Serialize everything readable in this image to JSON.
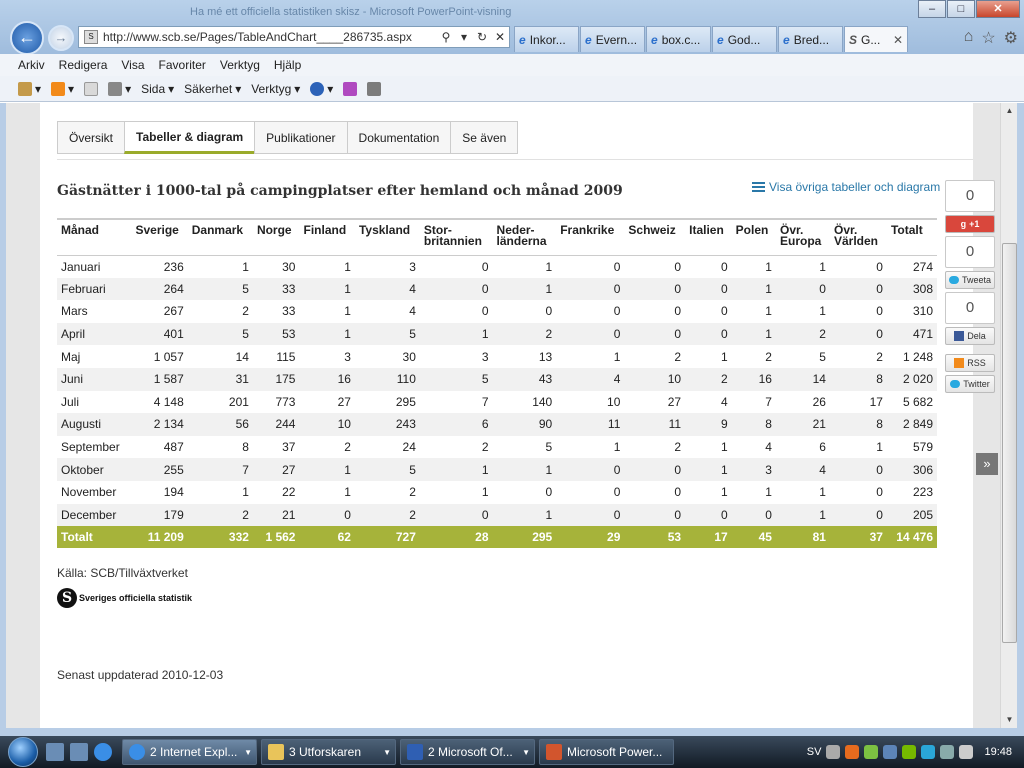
{
  "window": {
    "title": "Ha mé ett officiella statistiken skisz - Microsoft PowerPoint-visning"
  },
  "browser": {
    "url": "http://www.scb.se/Pages/TableAndChart____286735.aspx",
    "tabs": [
      {
        "label": "Inkor..."
      },
      {
        "label": "Evern..."
      },
      {
        "label": "box.c..."
      },
      {
        "label": "God..."
      },
      {
        "label": "Bred..."
      },
      {
        "label": "G..."
      }
    ],
    "menu": [
      "Arkiv",
      "Redigera",
      "Visa",
      "Favoriter",
      "Verktyg",
      "Hjälp"
    ],
    "toolbar": {
      "sida": "Sida",
      "sakerhet": "Säkerhet",
      "verktyg": "Verktyg"
    }
  },
  "content_tabs": [
    "Översikt",
    "Tabeller & diagram",
    "Publikationer",
    "Dokumentation",
    "Se även"
  ],
  "table_title": "Gästnätter i 1000-tal på campingplatser efter hemland och månad 2009",
  "more_link": "Visa övriga tabeller och diagram",
  "columns": [
    "Månad",
    "Sverige",
    "Danmark",
    "Norge",
    "Finland",
    "Tyskland",
    "Stor-\nbritannien",
    "Neder-\nländerna",
    "Frankrike",
    "Schweiz",
    "Italien",
    "Polen",
    "Övr.\nEuropa",
    "Övr.\nVärlden",
    "Totalt"
  ],
  "rows": [
    [
      "Januari",
      "236",
      "1",
      "30",
      "1",
      "3",
      "0",
      "1",
      "0",
      "0",
      "0",
      "1",
      "1",
      "0",
      "274"
    ],
    [
      "Februari",
      "264",
      "5",
      "33",
      "1",
      "4",
      "0",
      "1",
      "0",
      "0",
      "0",
      "1",
      "0",
      "0",
      "308"
    ],
    [
      "Mars",
      "267",
      "2",
      "33",
      "1",
      "4",
      "0",
      "0",
      "0",
      "0",
      "0",
      "1",
      "1",
      "0",
      "310"
    ],
    [
      "April",
      "401",
      "5",
      "53",
      "1",
      "5",
      "1",
      "2",
      "0",
      "0",
      "0",
      "1",
      "2",
      "0",
      "471"
    ],
    [
      "Maj",
      "1 057",
      "14",
      "115",
      "3",
      "30",
      "3",
      "13",
      "1",
      "2",
      "1",
      "2",
      "5",
      "2",
      "1 248"
    ],
    [
      "Juni",
      "1 587",
      "31",
      "175",
      "16",
      "110",
      "5",
      "43",
      "4",
      "10",
      "2",
      "16",
      "14",
      "8",
      "2 020"
    ],
    [
      "Juli",
      "4 148",
      "201",
      "773",
      "27",
      "295",
      "7",
      "140",
      "10",
      "27",
      "4",
      "7",
      "26",
      "17",
      "5 682"
    ],
    [
      "Augusti",
      "2 134",
      "56",
      "244",
      "10",
      "243",
      "6",
      "90",
      "11",
      "11",
      "9",
      "8",
      "21",
      "8",
      "2 849"
    ],
    [
      "September",
      "487",
      "8",
      "37",
      "2",
      "24",
      "2",
      "5",
      "1",
      "2",
      "1",
      "4",
      "6",
      "1",
      "579"
    ],
    [
      "Oktober",
      "255",
      "7",
      "27",
      "1",
      "5",
      "1",
      "1",
      "0",
      "0",
      "1",
      "3",
      "4",
      "0",
      "306"
    ],
    [
      "November",
      "194",
      "1",
      "22",
      "1",
      "2",
      "1",
      "0",
      "0",
      "0",
      "1",
      "1",
      "1",
      "0",
      "223"
    ],
    [
      "December",
      "179",
      "2",
      "21",
      "0",
      "2",
      "0",
      "1",
      "0",
      "0",
      "0",
      "0",
      "1",
      "0",
      "205"
    ]
  ],
  "total_row": [
    "Totalt",
    "11 209",
    "332",
    "1 562",
    "62",
    "727",
    "28",
    "295",
    "29",
    "53",
    "17",
    "45",
    "81",
    "37",
    "14 476"
  ],
  "source": "Källa: SCB/Tillväxtverket",
  "sos_label": "Sveriges officiella statistik",
  "updated": "Senast uppdaterad 2010-12-03",
  "social": {
    "gplus_count": "0",
    "gplus_label": "+1",
    "tweet_count": "0",
    "tweet_label": "Tweeta",
    "fb_count": "0",
    "fb_label": "Dela",
    "rss_label": "RSS",
    "twitter_label": "Twitter"
  },
  "taskbar": {
    "tasks": [
      {
        "label": "2 Internet Expl..."
      },
      {
        "label": "3 Utforskaren"
      },
      {
        "label": "2 Microsoft Of..."
      },
      {
        "label": "Microsoft Power..."
      }
    ],
    "lang": "SV",
    "clock": "19:48"
  }
}
